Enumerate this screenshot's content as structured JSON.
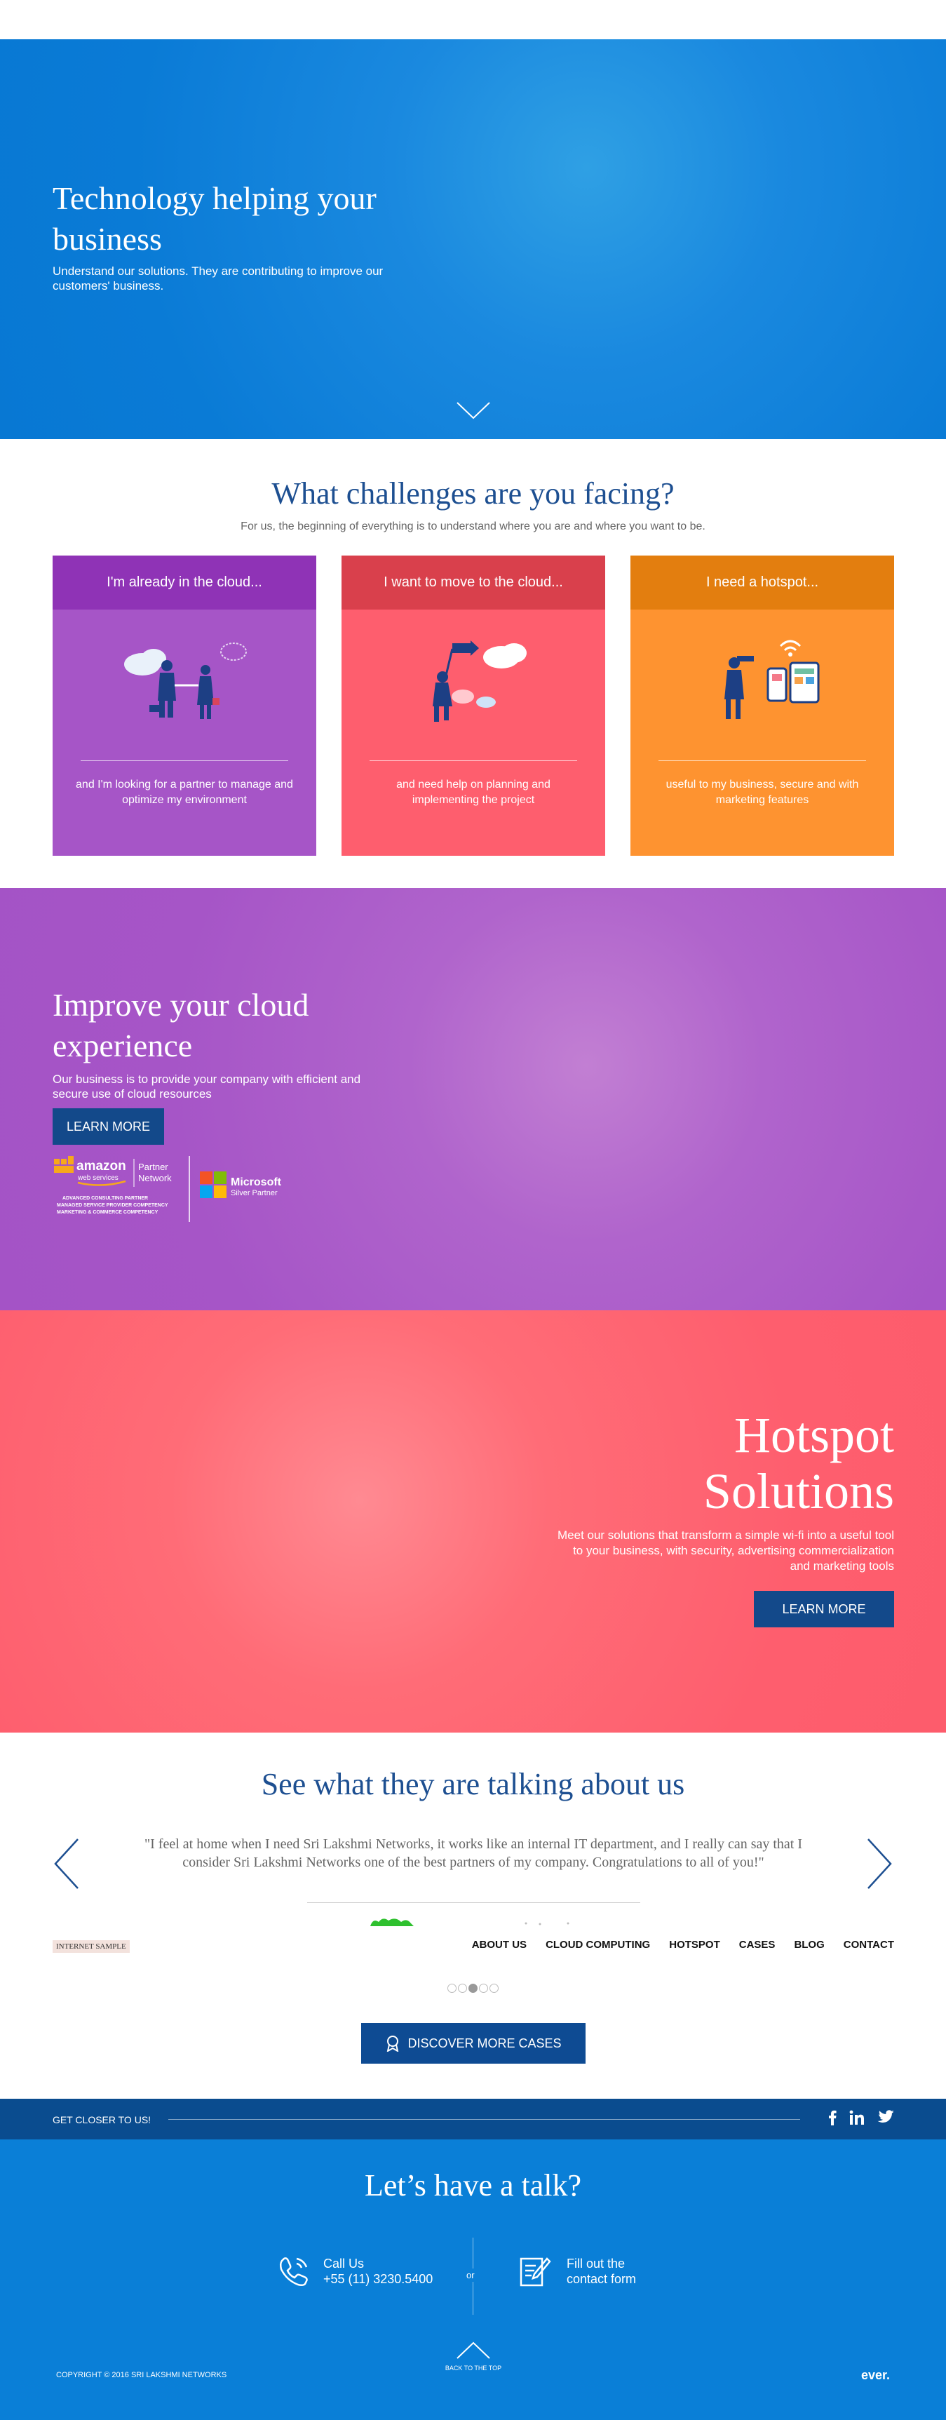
{
  "hero": {
    "title": "Technology helping your business",
    "subtitle": "Understand our solutions. They are contributing to improve our customers' business."
  },
  "challenges": {
    "title": "What challenges are you facing?",
    "subtitle": "For us, the beginning of everything is to understand where you are and where you want to be.",
    "cards": [
      {
        "head": "I'm already in the cloud...",
        "text": "and I'm looking for a partner to manage and optimize my environment"
      },
      {
        "head": "I want to move to the cloud...",
        "text": "and need help on planning and implementing the project"
      },
      {
        "head": "I need a hotspot...",
        "text": "useful to my business, secure and with marketing features"
      }
    ]
  },
  "cloud": {
    "title": "Improve your cloud experience",
    "subtitle": "Our business is to provide your company with efficient and secure use of cloud resources",
    "button": "LEARN MORE",
    "aws_name": "amazon",
    "aws_sub": "web services",
    "aws_partner": "Partner",
    "aws_network": "Network",
    "aws_lines": [
      "ADVANCED CONSULTING PARTNER",
      "MANAGED SERVICE PROVIDER COMPETENCY",
      "MARKETING & COMMERCE COMPETENCY"
    ],
    "ms_name": "Microsoft",
    "ms_sub": "Silver Partner"
  },
  "hotspot": {
    "title_line1": "Hotspot",
    "title_line2": "Solutions",
    "subtitle": "Meet our solutions that transform a simple wi-fi into a useful tool to your business, with security, advertising commercialization and marketing tools",
    "button": "LEARN MORE"
  },
  "testimonials": {
    "title": "See what they are talking about us",
    "quote": "\"I feel at home when I need Sri Lakshmi Networks, it works like an internal IT department, and I really can say that I consider Sri Lakshmi Networks one of the best partners of my company. Congratulations to all of you!\"",
    "badge": "INTERNET SAMPLE",
    "nav": [
      "ABOUT US",
      "CLOUD COMPUTING",
      "HOTSPOT",
      "CASES",
      "BLOG",
      "CONTACT"
    ],
    "dot_count": 5,
    "active_dot": 3,
    "button": "DISCOVER MORE CASES"
  },
  "closer": {
    "label": "GET CLOSER TO US!",
    "social": [
      "facebook-icon",
      "linkedin-icon",
      "twitter-icon"
    ]
  },
  "footer": {
    "title": "Let’s have a talk?",
    "call_label": "Call Us",
    "call_number": "+55 (11) 3230.5400",
    "or": "or",
    "form_line1": "Fill out the",
    "form_line2": "contact form",
    "copyright": "COPYRIGHT © 2016 SRI LAKSHMI NETWORKS",
    "back_to_top": "BACK TO THE TOP",
    "brand": "ever."
  },
  "colors": {
    "blue": "#0a7fd7",
    "navy": "#13498a",
    "purple": "#a655c7",
    "coral": "#fe5e6e",
    "orange": "#fe9330"
  }
}
